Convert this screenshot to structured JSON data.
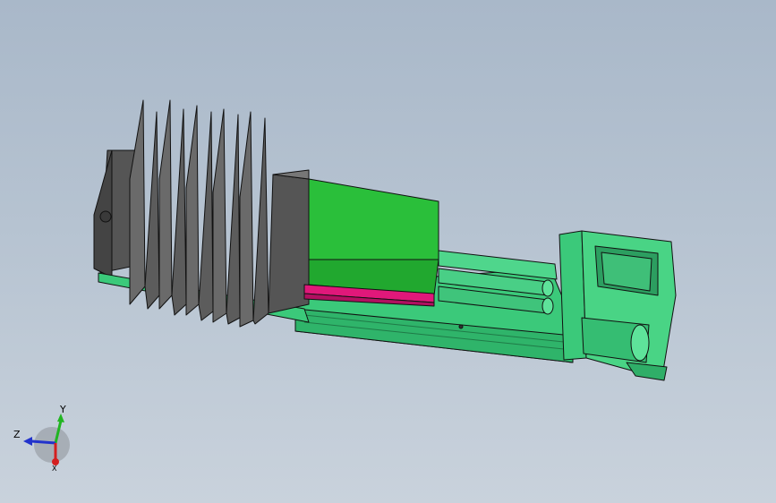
{
  "view": {
    "background_top": "#a9b8c9",
    "background_bottom": "#c9d2dc"
  },
  "model": {
    "carriage_color": "#2abf3a",
    "rail_color": "#3fcf80",
    "bellows_color": "#6a6a6a",
    "strip_color": "#e0187a",
    "edge_color": "#111111"
  },
  "triad": {
    "x_label": "X",
    "y_label": "Y",
    "z_label": "Z",
    "x_color": "#d41f1f",
    "y_color": "#21b521",
    "z_color": "#2233cc"
  }
}
